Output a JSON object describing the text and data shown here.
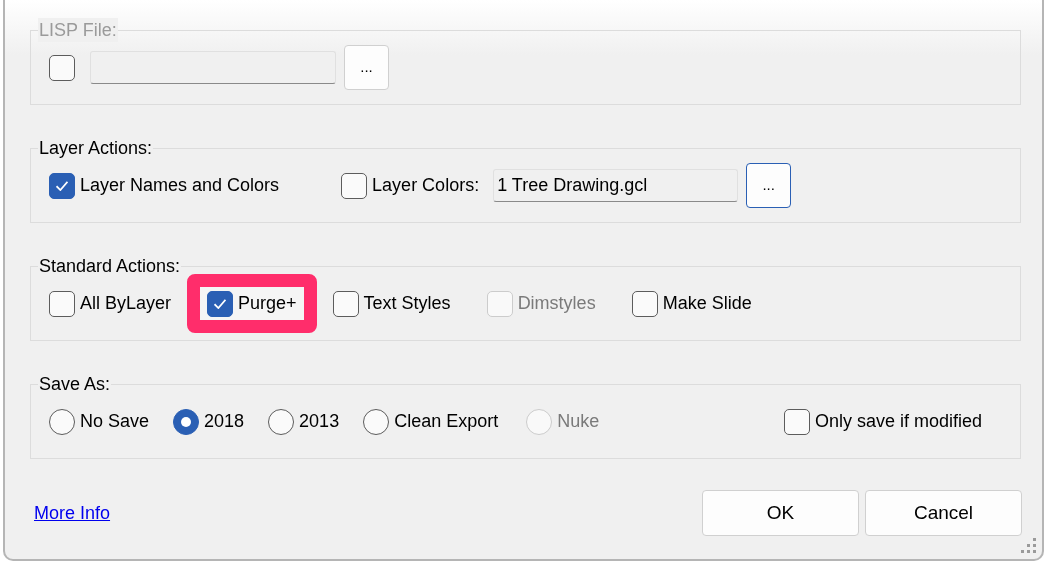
{
  "groups": [
    {
      "title": "LISP File:",
      "disabled": true,
      "items": [
        {
          "kind": "checkbox",
          "checked": false,
          "disabled": false
        },
        {
          "kind": "field",
          "value": ""
        },
        {
          "kind": "browse",
          "label": "...",
          "focused": false
        }
      ]
    },
    {
      "title": "Layer Actions:",
      "disabled": false,
      "items": [
        {
          "kind": "checkbox",
          "label": "Layer Names and Colors",
          "checked": true,
          "disabled": false
        },
        {
          "kind": "checkbox",
          "label": "Layer Colors:",
          "checked": false,
          "disabled": false
        },
        {
          "kind": "field",
          "value": "1 Tree Drawing.gcl"
        },
        {
          "kind": "browse",
          "label": "...",
          "focused": true
        }
      ]
    },
    {
      "title": "Standard Actions:",
      "disabled": false,
      "items": [
        {
          "kind": "checkbox",
          "label": "All ByLayer",
          "checked": false,
          "disabled": false,
          "highlighted": false
        },
        {
          "kind": "checkbox",
          "label": "Purge+",
          "checked": true,
          "disabled": false,
          "highlighted": true
        },
        {
          "kind": "checkbox",
          "label": "Text Styles",
          "checked": false,
          "disabled": false,
          "highlighted": false
        },
        {
          "kind": "checkbox",
          "label": "Dimstyles",
          "checked": false,
          "disabled": true,
          "highlighted": false
        },
        {
          "kind": "checkbox",
          "label": "Make Slide",
          "checked": false,
          "disabled": false,
          "highlighted": false
        }
      ]
    },
    {
      "title": "Save As:",
      "disabled": false,
      "items": [
        {
          "kind": "radio",
          "label": "No Save",
          "selected": false,
          "disabled": false
        },
        {
          "kind": "radio",
          "label": "2018",
          "selected": true,
          "disabled": false
        },
        {
          "kind": "radio",
          "label": "2013",
          "selected": false,
          "disabled": false
        },
        {
          "kind": "radio",
          "label": "Clean Export",
          "selected": false,
          "disabled": false
        },
        {
          "kind": "radio",
          "label": "Nuke",
          "selected": false,
          "disabled": true
        },
        {
          "kind": "checkbox",
          "label": "Only save if modified",
          "checked": false,
          "disabled": false
        }
      ]
    }
  ],
  "link": "More Info",
  "buttons": [
    "OK",
    "Cancel"
  ]
}
